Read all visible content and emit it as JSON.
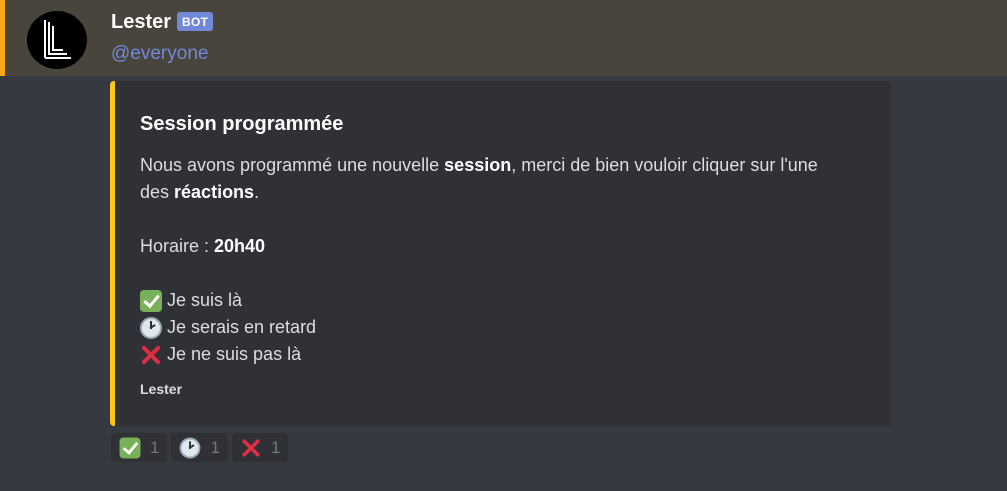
{
  "message": {
    "author": "Lester",
    "bot_tag": "BOT",
    "mention": "@everyone",
    "avatar_icon": "lester-logo-icon",
    "colors": {
      "mention_highlight": "#49443c",
      "mention_bar": "#faa61a",
      "embed_accent": "#ffc61c",
      "bot_tag": "#7289da"
    }
  },
  "embed": {
    "title": "Session programmée",
    "line1_a": "Nous avons programmé une nouvelle ",
    "line1_bold": "session",
    "line1_b": ", merci de bien vouloir cliquer sur l'une",
    "line2_a": "des ",
    "line2_bold": "réactions",
    "line2_b": ".",
    "schedule_label": "Horaire : ",
    "schedule_time": "20h40",
    "options": [
      {
        "icon": "check-mark-icon",
        "label": "Je suis là"
      },
      {
        "icon": "clock-icon",
        "label": "Je serais en retard"
      },
      {
        "icon": "cross-mark-icon",
        "label": "Je ne suis pas là"
      }
    ],
    "footer": "Lester"
  },
  "reactions": [
    {
      "icon": "check-mark-icon",
      "count": "1"
    },
    {
      "icon": "clock-icon",
      "count": "1"
    },
    {
      "icon": "cross-mark-icon",
      "count": "1"
    }
  ]
}
